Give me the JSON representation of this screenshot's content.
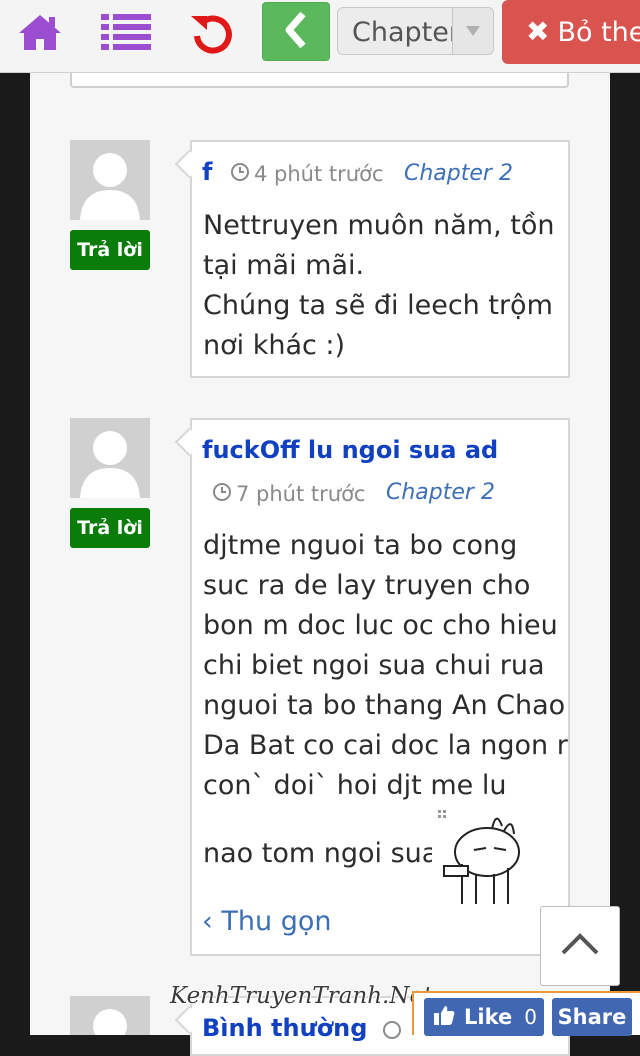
{
  "toolbar": {
    "home_icon": "home-icon",
    "list_icon": "list-icon",
    "reload_icon": "reload-icon",
    "back_icon": "chevron-left-icon",
    "chapter_select_value": "Chapter",
    "close_label": "Bỏ the",
    "colors": {
      "icon": "#9b4fd0",
      "reload": "#e01818",
      "back": "#5cb85c",
      "close": "#d9534f"
    }
  },
  "comments": [
    {
      "user": "f",
      "time": "4 phút trước",
      "chapter": "Chapter 2",
      "reply_label": "Trả lời",
      "lines": [
        "Nettruyen muôn năm, tồn",
        "tại mãi mãi.",
        "Chúng ta sẽ đi leech trộm",
        "nơi khác :)"
      ]
    },
    {
      "user": "fuckOff lu ngoi sua ad",
      "time": "7 phút trước",
      "chapter": "Chapter 2",
      "reply_label": "Trả lời",
      "lines": [
        "djtme nguoi ta bo cong",
        "suc ra de lay truyen cho",
        "bon m doc luc oc cho hieu",
        "chi biet ngoi sua chui rua",
        "nguoi ta bo thang An Chao",
        "Da Bat co cai doc la ngon r",
        "con` doi` hoi djt me lu"
      ],
      "last_line": "nao tom ngoi sua",
      "collapse_label": "Thu gọn"
    },
    {
      "user": "Bình thường"
    }
  ],
  "watermark": "KenhTruyenTranh.Net",
  "facebook": {
    "like_label": "Like",
    "like_count": "0",
    "share_label": "Share"
  }
}
